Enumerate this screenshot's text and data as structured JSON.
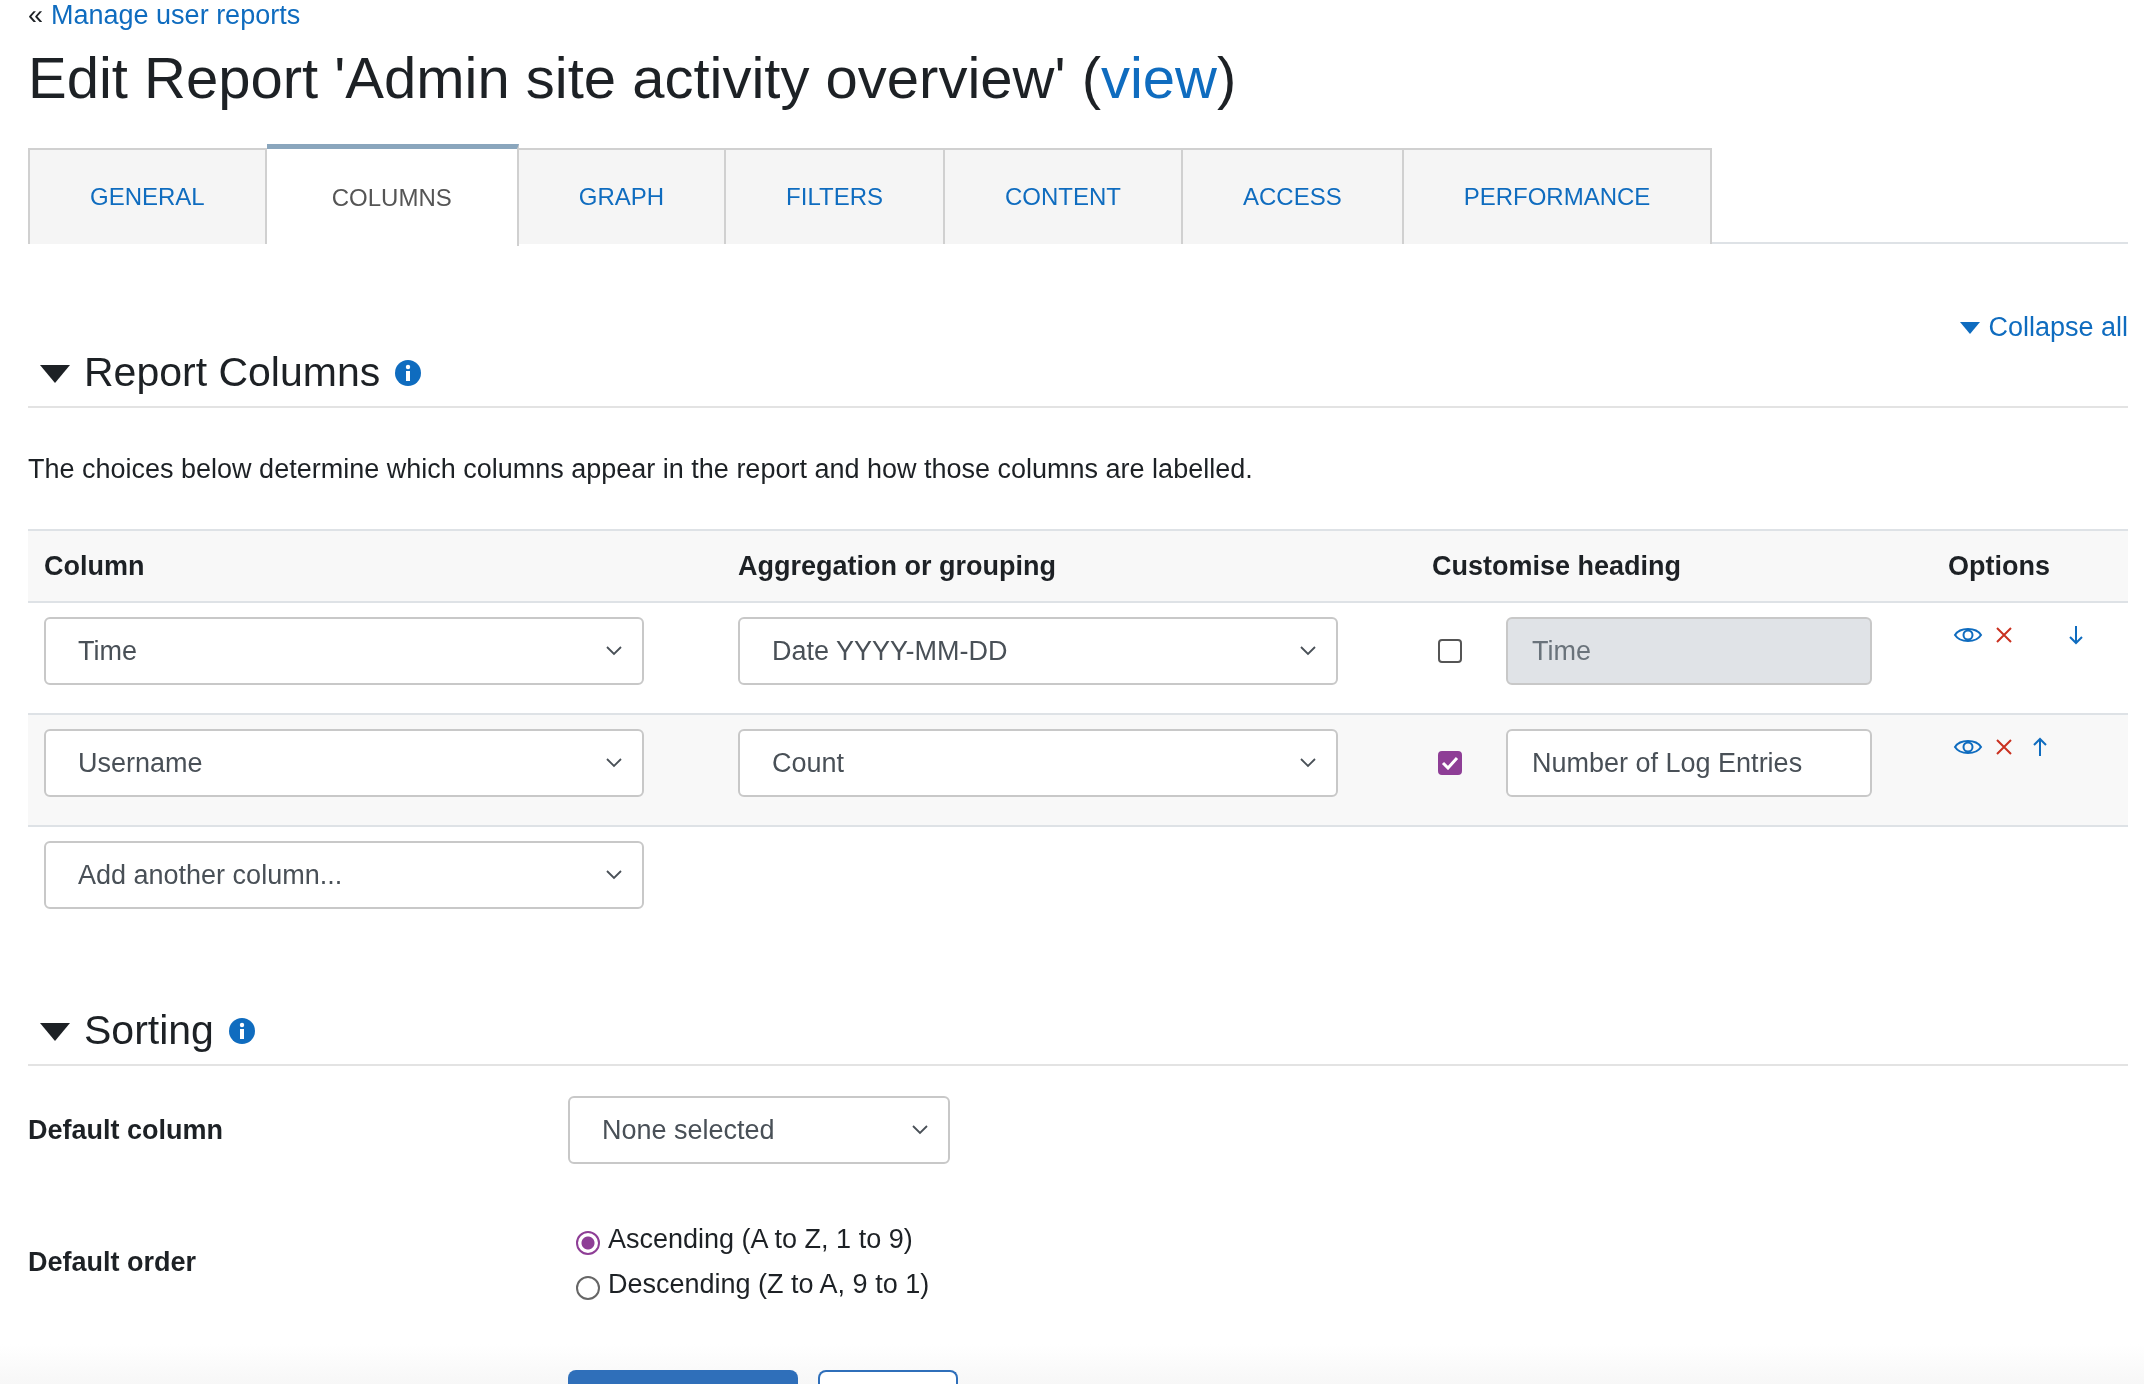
{
  "breadcrumb": {
    "prefix": "«",
    "link": "Manage user reports"
  },
  "title": {
    "text": "Edit Report 'Admin site activity overview' (",
    "link": "view",
    "suffix": ")"
  },
  "tabs": [
    {
      "label": "GENERAL",
      "selected": false
    },
    {
      "label": "COLUMNS",
      "selected": true
    },
    {
      "label": "GRAPH",
      "selected": false
    },
    {
      "label": "FILTERS",
      "selected": false
    },
    {
      "label": "CONTENT",
      "selected": false
    },
    {
      "label": "ACCESS",
      "selected": false
    },
    {
      "label": "PERFORMANCE",
      "selected": false
    }
  ],
  "collapse_all": "Collapse all",
  "report_columns": {
    "heading": "Report Columns",
    "expanded": true,
    "description": "The choices below determine which columns appear in the report and how those columns are labelled.",
    "columns": [
      "Column",
      "Aggregation or grouping",
      "Customise heading",
      "Options"
    ],
    "rows": [
      {
        "column": "Time",
        "aggregation": "Date YYYY-MM-DD",
        "customise": false,
        "heading": "Time",
        "actions": [
          {
            "kind": "show"
          },
          {
            "kind": "delete"
          },
          {
            "kind": "move_down"
          }
        ]
      },
      {
        "column": "Username",
        "aggregation": "Count",
        "customise": true,
        "heading": "Number of Log Entries",
        "actions": [
          {
            "kind": "show"
          },
          {
            "kind": "delete"
          },
          {
            "kind": "move_up"
          }
        ]
      }
    ],
    "add_column": "Add another column..."
  },
  "sorting": {
    "heading": "Sorting",
    "expanded": true,
    "default_column": {
      "label": "Default column",
      "value": "None selected"
    },
    "default_order": {
      "label": "Default order",
      "options": [
        {
          "label": "Ascending (A to Z, 1 to 9)",
          "selected": true
        },
        {
          "label": "Descending (Z to A, 9 to 1)",
          "selected": false
        }
      ]
    }
  },
  "buttons": [
    {
      "kind": "primary"
    },
    {
      "kind": "secondary"
    }
  ]
}
